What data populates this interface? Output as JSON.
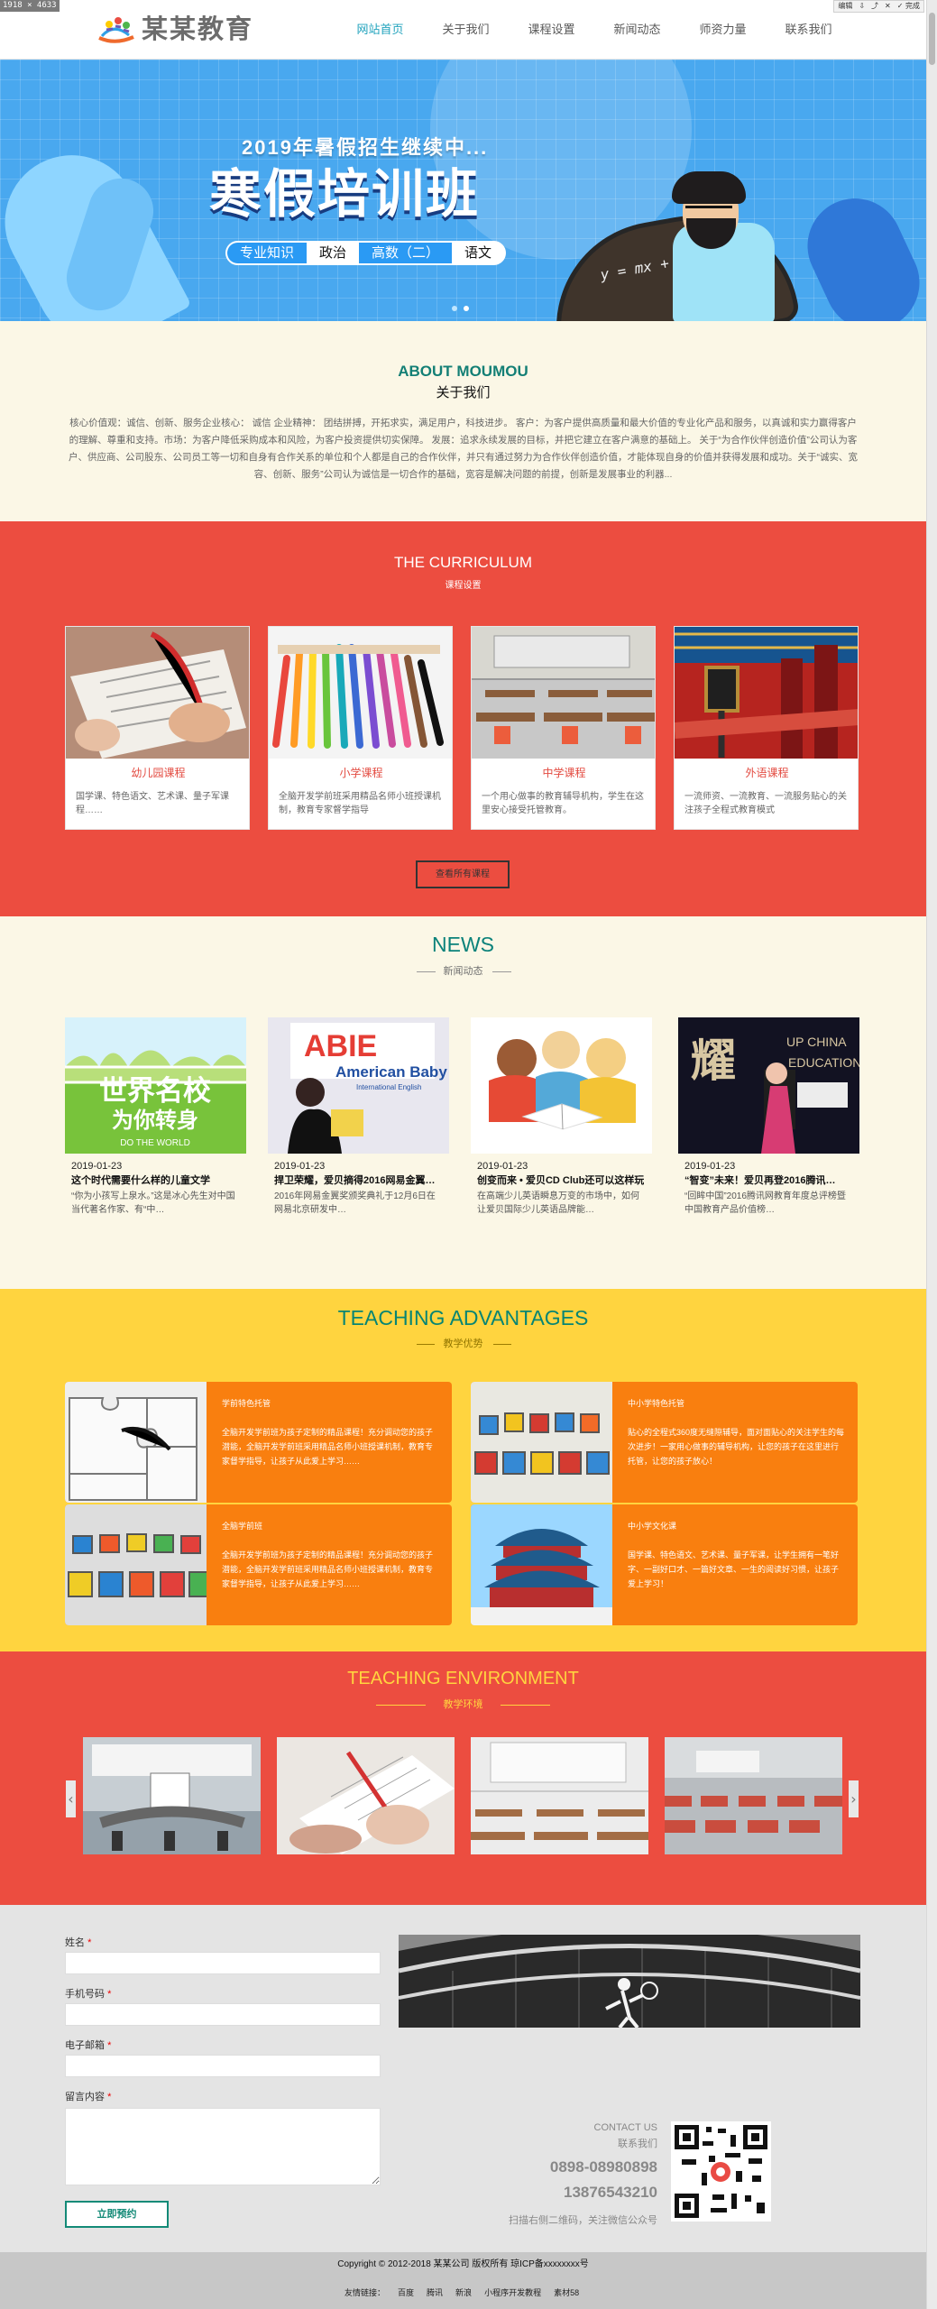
{
  "browser": {
    "size_text": "1918 × 4633",
    "edit": "编辑",
    "done": "完成"
  },
  "header": {
    "brand": "某某教育",
    "nav": [
      {
        "label": "网站首页",
        "active": true
      },
      {
        "label": "关于我们"
      },
      {
        "label": "课程设置"
      },
      {
        "label": "新闻动态"
      },
      {
        "label": "师资力量"
      },
      {
        "label": "联系我们"
      }
    ]
  },
  "hero": {
    "subtitle": "2019年暑假招生继续中...",
    "title": "寒假培训班",
    "pills": [
      "专业知识",
      "政治",
      "高数（二）",
      "语文"
    ],
    "board_text": "y = mx + b"
  },
  "about": {
    "title_en": "ABOUT MOUMOU",
    "title_cn": "关于我们",
    "text": "核心价值观：诚信、创新、服务企业核心： 诚信 企业精神： 团结拼搏，开拓求实，满足用户，科技进步。 客户：为客户提供高质量和最大价值的专业化产品和服务，以真诚和实力赢得客户的理解、尊重和支持。市场：为客户降低采购成本和风险，为客户投资提供切实保障。 发展：追求永续发展的目标，并把它建立在客户满意的基础上。 关于“为合作伙伴创造价值”公司认为客户、供应商、公司股东、公司员工等一切和自身有合作关系的单位和个人都是自己的合作伙伴，并只有通过努力为合作伙伴创造价值，才能体现自身的价值并获得发展和成功。关于“诚实、宽容、创新、服务”公司认为诚信是一切合作的基础，宽容是解决问题的前提，创新是发展事业的利器..."
  },
  "curriculum": {
    "title_en": "THE CURRICULUM",
    "title_cn": "课程设置",
    "button": "查看所有课程",
    "courses": [
      {
        "title": "幼儿园课程",
        "desc": "国学课、特色语文、艺术课、量子军课程……"
      },
      {
        "title": "小学课程",
        "desc": "全脑开发学前班采用精品名师小班授课机制，教育专家督学指导"
      },
      {
        "title": "中学课程",
        "desc": "一个用心做事的教育辅导机构，学生在这里安心接受托管教育。"
      },
      {
        "title": "外语课程",
        "desc": "一流师资、一流教育、一流服务贴心的关注孩子全程式教育模式"
      }
    ]
  },
  "news": {
    "title_en": "NEWS",
    "title_cn": "新闻动态",
    "items": [
      {
        "date": "2019-01-23",
        "title": "这个时代需要什么样的儿童文学",
        "desc": "“你为小孩写上泉水。”这是冰心先生对中国当代著名作家、有“中…",
        "image_text": "世界名校",
        "image_sub": "为你转身",
        "image_sub2": "DO THE WORLD"
      },
      {
        "date": "2019-01-23",
        "title": "捍卫荣耀，爱贝摘得2016网易金翼…",
        "desc": "2016年网易金翼奖颁奖典礼于12月6日在网易北京研发中…",
        "image_text": "ABIE",
        "image_sub": "American Baby",
        "image_sub2": "International English"
      },
      {
        "date": "2019-01-23",
        "title": "创变而来 • 爱贝CD Club还可以这样玩",
        "desc": "在高端少儿英语瞬息万变的市场中，如何让爱贝国际少儿英语品牌能…"
      },
      {
        "date": "2019-01-23",
        "title": "“智变”未来！爱贝再登2016腾讯…",
        "desc": "“回眸中国”2016腾讯网教育年度总评榜暨中国教育产品价值榜…",
        "image_text": "耀",
        "image_sub": "UP CHINA",
        "image_sub2": "EDUCATION"
      }
    ]
  },
  "advantages": {
    "title_en": "TEACHING ADVANTAGES",
    "title_cn": "教学优势",
    "items": [
      {
        "title": "学前特色托管",
        "desc": "全脑开发学前班为孩子定制的精品课程！充分调动您的孩子潜能，全脑开发学前班采用精品名师小班授课机制，教育专家督学指导，让孩子从此爱上学习……"
      },
      {
        "title": "中小学特色托管",
        "desc": "贴心的全程式360度无缝隙辅导，面对面贴心的关注学生的每次进步！一家用心做事的辅导机构，让您的孩子在这里进行托管，让您的孩子放心！"
      },
      {
        "title": "全脑学前班",
        "desc": "全脑开发学前班为孩子定制的精品课程！充分调动您的孩子潜能，全脑开发学前班采用精品名师小班授课机制，教育专家督学指导，让孩子从此爱上学习……"
      },
      {
        "title": "中小学文化课",
        "desc": "国学课、特色语文、艺术课、量子军课，让学生拥有一笔好字、一副好口才、一篇好文章、一生的阅读好习惯，让孩子爱上学习！"
      }
    ]
  },
  "environment": {
    "title_en": "TEACHING ENVIRONMENT",
    "title_cn": "教学环境"
  },
  "contact": {
    "labels": {
      "name": "姓名",
      "phone": "手机号码",
      "email": "电子邮箱",
      "message": "留言内容"
    },
    "submit": "立即预约",
    "contact_us": "CONTACT US",
    "contact_cn": "联系我们",
    "phone1": "0898-08980898",
    "phone2": "13876543210",
    "qr_text": "扫描右侧二维码，关注微信公众号"
  },
  "footer": {
    "copyright": "Copyright © 2012-2018 某某公司 版权所有 琼ICP备xxxxxxxx号",
    "links_label": "友情链接：",
    "links": [
      "百度",
      "腾讯",
      "新浪",
      "小程序开发教程",
      "素材58"
    ]
  }
}
